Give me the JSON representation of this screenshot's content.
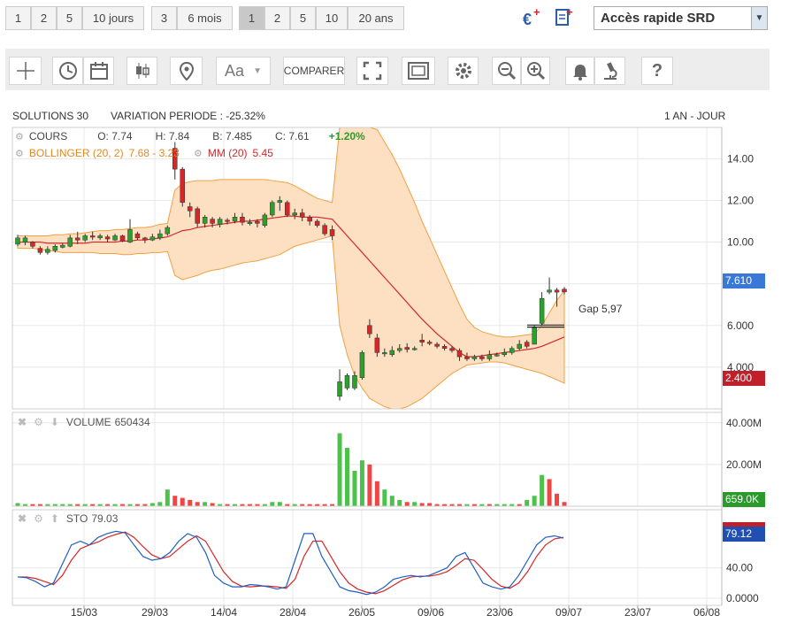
{
  "ranges_days": [
    "1",
    "2",
    "5",
    "10 jours"
  ],
  "ranges_months": [
    "3",
    "6 mois"
  ],
  "ranges_years": [
    "1",
    "2",
    "5",
    "10",
    "20 ans"
  ],
  "quick_access": "Accès rapide SRD",
  "compare_label": "COMPARER",
  "font_label": "Aa",
  "header": {
    "name": "SOLUTIONS 30",
    "variation": "VARIATION PERIODE : -25.32%",
    "period": "1 AN - JOUR"
  },
  "cours": {
    "label": "COURS",
    "o": "O: 7.74",
    "h": "H: 7.84",
    "b": "B: 7.485",
    "c": "C: 7.61",
    "change": "+1.20%"
  },
  "bollinger": {
    "label": "BOLLINGER (20, 2)",
    "values": "7.68 - 3.23"
  },
  "mm": {
    "label": "MM (20)",
    "value": "5.45"
  },
  "volume": {
    "label": "VOLUME",
    "value": "650434"
  },
  "sto": {
    "label": "STO",
    "value": "79.03"
  },
  "gap_label": "Gap 5,97",
  "badges": {
    "last_price": "7.610",
    "low_price": "2.400",
    "volume": "659.0K",
    "sto": "79.12"
  },
  "colors": {
    "up": "#2ca02c",
    "down": "#d62728",
    "band_fill": "#fde0c2",
    "band_line": "#f0a040",
    "mm": "#d62728",
    "sto_k": "#1f5fbf",
    "sto_d": "#d62728",
    "price_badge": "#3a78d8",
    "low_badge": "#c0202a",
    "vol_badge": "#2a9a2a"
  },
  "chart_data": {
    "type": "candlestick",
    "x_ticks": [
      "15/03",
      "29/03",
      "14/04",
      "28/04",
      "26/05",
      "09/06",
      "23/06",
      "09/07",
      "23/07",
      "06/08"
    ],
    "price_axis": {
      "ticks": [
        "14.00",
        "12.00",
        "10.00",
        "8.000",
        "6.000",
        "4.000"
      ],
      "ylim": [
        2.0,
        15.5
      ]
    },
    "volume_axis": {
      "ticks": [
        "40.00M",
        "20.00M"
      ]
    },
    "sto_axis": {
      "ticks": [
        "40.00",
        "0.0000"
      ]
    },
    "candles": [
      {
        "o": 9.9,
        "c": 10.2,
        "h": 10.35,
        "l": 9.8
      },
      {
        "o": 10.0,
        "c": 10.2,
        "h": 10.3,
        "l": 9.85
      },
      {
        "o": 10.0,
        "c": 9.8,
        "h": 10.05,
        "l": 9.7
      },
      {
        "o": 9.7,
        "c": 9.5,
        "h": 9.8,
        "l": 9.4
      },
      {
        "o": 9.5,
        "c": 9.65,
        "h": 9.8,
        "l": 9.4
      },
      {
        "o": 9.6,
        "c": 9.8,
        "h": 9.9,
        "l": 9.5
      },
      {
        "o": 9.75,
        "c": 9.85,
        "h": 9.95,
        "l": 9.7
      },
      {
        "o": 9.8,
        "c": 10.2,
        "h": 10.35,
        "l": 9.75
      },
      {
        "o": 10.2,
        "c": 10.1,
        "h": 10.5,
        "l": 9.9
      },
      {
        "o": 10.1,
        "c": 10.3,
        "h": 10.4,
        "l": 10.0
      },
      {
        "o": 10.3,
        "c": 10.25,
        "h": 10.5,
        "l": 10.1
      },
      {
        "o": 10.2,
        "c": 10.3,
        "h": 10.4,
        "l": 10.1
      },
      {
        "o": 10.25,
        "c": 10.15,
        "h": 10.35,
        "l": 10.0
      },
      {
        "o": 10.1,
        "c": 10.3,
        "h": 10.4,
        "l": 10.05
      },
      {
        "o": 10.3,
        "c": 10.05,
        "h": 10.35,
        "l": 10.0
      },
      {
        "o": 10.0,
        "c": 10.6,
        "h": 11.1,
        "l": 9.95
      },
      {
        "o": 10.4,
        "c": 10.2,
        "h": 10.5,
        "l": 10.1
      },
      {
        "o": 10.2,
        "c": 10.1,
        "h": 10.25,
        "l": 9.95
      },
      {
        "o": 10.1,
        "c": 10.25,
        "h": 10.4,
        "l": 10.05
      },
      {
        "o": 10.2,
        "c": 10.4,
        "h": 10.6,
        "l": 10.1
      },
      {
        "o": 10.4,
        "c": 10.7,
        "h": 10.8,
        "l": 10.3
      },
      {
        "o": 14.5,
        "c": 13.5,
        "h": 14.8,
        "l": 13.0
      },
      {
        "o": 13.5,
        "c": 11.9,
        "h": 13.6,
        "l": 11.7
      },
      {
        "o": 11.7,
        "c": 11.5,
        "h": 11.9,
        "l": 11.2
      },
      {
        "o": 11.6,
        "c": 10.9,
        "h": 11.7,
        "l": 10.7
      },
      {
        "o": 10.9,
        "c": 11.2,
        "h": 11.3,
        "l": 10.7
      },
      {
        "o": 11.1,
        "c": 10.9,
        "h": 11.2,
        "l": 10.7
      },
      {
        "o": 10.85,
        "c": 11.1,
        "h": 11.2,
        "l": 10.7
      },
      {
        "o": 11.05,
        "c": 11.0,
        "h": 11.15,
        "l": 10.85
      },
      {
        "o": 11.0,
        "c": 11.2,
        "h": 11.4,
        "l": 10.9
      },
      {
        "o": 11.2,
        "c": 10.95,
        "h": 11.4,
        "l": 10.8
      },
      {
        "o": 10.9,
        "c": 10.95,
        "h": 11.1,
        "l": 10.8
      },
      {
        "o": 11.0,
        "c": 10.9,
        "h": 11.1,
        "l": 10.7
      },
      {
        "o": 10.8,
        "c": 11.3,
        "h": 11.4,
        "l": 10.7
      },
      {
        "o": 11.3,
        "c": 11.9,
        "h": 12.0,
        "l": 11.2
      },
      {
        "o": 11.9,
        "c": 12.0,
        "h": 12.2,
        "l": 11.5
      },
      {
        "o": 11.9,
        "c": 11.3,
        "h": 12.0,
        "l": 11.2
      },
      {
        "o": 11.3,
        "c": 11.4,
        "h": 11.6,
        "l": 11.1
      },
      {
        "o": 11.4,
        "c": 11.2,
        "h": 11.6,
        "l": 11.0
      },
      {
        "o": 11.2,
        "c": 11.0,
        "h": 11.3,
        "l": 10.8
      },
      {
        "o": 11.0,
        "c": 10.8,
        "h": 11.1,
        "l": 10.7
      },
      {
        "o": 10.8,
        "c": 10.4,
        "h": 10.9,
        "l": 10.3
      },
      {
        "o": 10.6,
        "c": 10.3,
        "h": 10.8,
        "l": 10.1
      },
      {
        "o": 2.6,
        "c": 3.3,
        "h": 3.9,
        "l": 2.4
      },
      {
        "o": 3.0,
        "c": 3.6,
        "h": 3.7,
        "l": 2.9
      },
      {
        "o": 3.0,
        "c": 3.6,
        "h": 3.8,
        "l": 2.9
      },
      {
        "o": 3.5,
        "c": 4.7,
        "h": 4.8,
        "l": 3.4
      },
      {
        "o": 6.0,
        "c": 5.6,
        "h": 6.3,
        "l": 5.4
      },
      {
        "o": 5.4,
        "c": 4.7,
        "h": 5.6,
        "l": 4.5
      },
      {
        "o": 4.7,
        "c": 4.7,
        "h": 4.9,
        "l": 4.5
      },
      {
        "o": 4.6,
        "c": 4.8,
        "h": 5.0,
        "l": 4.5
      },
      {
        "o": 4.8,
        "c": 4.9,
        "h": 5.1,
        "l": 4.7
      },
      {
        "o": 4.95,
        "c": 4.85,
        "h": 5.15,
        "l": 4.7
      },
      {
        "o": 4.9,
        "c": 4.9,
        "h": 5.0,
        "l": 4.8
      },
      {
        "o": 5.3,
        "c": 5.2,
        "h": 5.6,
        "l": 5.0
      },
      {
        "o": 5.2,
        "c": 5.15,
        "h": 5.3,
        "l": 5.05
      },
      {
        "o": 5.1,
        "c": 5.0,
        "h": 5.2,
        "l": 4.9
      },
      {
        "o": 5.0,
        "c": 4.9,
        "h": 5.1,
        "l": 4.8
      },
      {
        "o": 4.9,
        "c": 4.8,
        "h": 5.0,
        "l": 4.7
      },
      {
        "o": 4.8,
        "c": 4.5,
        "h": 4.9,
        "l": 4.3
      },
      {
        "o": 4.5,
        "c": 4.4,
        "h": 4.7,
        "l": 4.3
      },
      {
        "o": 4.4,
        "c": 4.5,
        "h": 4.6,
        "l": 4.3
      },
      {
        "o": 4.5,
        "c": 4.4,
        "h": 4.6,
        "l": 4.3
      },
      {
        "o": 4.4,
        "c": 4.6,
        "h": 4.8,
        "l": 4.3
      },
      {
        "o": 4.6,
        "c": 4.6,
        "h": 4.7,
        "l": 4.5
      },
      {
        "o": 4.6,
        "c": 4.7,
        "h": 4.9,
        "l": 4.5
      },
      {
        "o": 4.7,
        "c": 4.9,
        "h": 5.0,
        "l": 4.6
      },
      {
        "o": 4.9,
        "c": 5.1,
        "h": 5.3,
        "l": 4.8
      },
      {
        "o": 5.2,
        "c": 5.0,
        "h": 5.3,
        "l": 4.9
      },
      {
        "o": 5.1,
        "c": 5.9,
        "h": 6.0,
        "l": 5.1
      },
      {
        "o": 6.1,
        "c": 7.3,
        "h": 7.6,
        "l": 6.0
      },
      {
        "o": 7.6,
        "c": 7.7,
        "h": 8.3,
        "l": 7.5
      },
      {
        "o": 7.7,
        "c": 7.6,
        "h": 7.8,
        "l": 6.9
      },
      {
        "o": 7.74,
        "c": 7.61,
        "h": 7.84,
        "l": 7.485
      }
    ],
    "mm20": [
      10.0,
      10.0,
      10.0,
      10.0,
      9.95,
      9.95,
      9.95,
      9.95,
      9.95,
      9.95,
      10.0,
      10.0,
      10.0,
      10.0,
      10.05,
      10.05,
      10.1,
      10.1,
      10.15,
      10.2,
      10.25,
      10.4,
      10.55,
      10.6,
      10.7,
      10.75,
      10.8,
      10.85,
      10.9,
      10.95,
      11.0,
      11.0,
      11.05,
      11.1,
      11.15,
      11.2,
      11.25,
      11.25,
      11.2,
      11.2,
      11.2,
      11.15,
      11.1,
      10.7,
      10.3,
      9.9,
      9.5,
      9.1,
      8.7,
      8.3,
      7.9,
      7.5,
      7.1,
      6.7,
      6.3,
      5.95,
      5.6,
      5.3,
      5.0,
      4.7,
      4.5,
      4.5,
      4.55,
      4.6,
      4.65,
      4.7,
      4.75,
      4.8,
      4.85,
      4.9,
      5.0,
      5.15,
      5.3,
      5.45
    ],
    "boll_upper": [
      10.3,
      10.3,
      10.3,
      10.3,
      10.3,
      10.35,
      10.35,
      10.4,
      10.4,
      10.45,
      10.5,
      10.55,
      10.55,
      10.6,
      10.6,
      10.65,
      10.7,
      10.7,
      10.75,
      10.85,
      10.9,
      12.5,
      12.8,
      12.9,
      12.95,
      12.95,
      12.95,
      13.0,
      13.0,
      13.0,
      13.0,
      13.0,
      13.0,
      13.0,
      12.95,
      12.9,
      12.85,
      12.7,
      12.5,
      12.3,
      12.1,
      12.0,
      11.9,
      15.5,
      16.0,
      16.2,
      16.0,
      15.8,
      15.4,
      14.8,
      14.2,
      13.5,
      12.7,
      11.9,
      11.0,
      10.2,
      9.4,
      8.6,
      7.8,
      7.0,
      6.3,
      5.9,
      5.7,
      5.6,
      5.5,
      5.45,
      5.45,
      5.5,
      5.55,
      5.6,
      6.0,
      6.6,
      7.2,
      7.68
    ],
    "boll_lower": [
      9.7,
      9.7,
      9.7,
      9.65,
      9.6,
      9.55,
      9.5,
      9.5,
      9.5,
      9.5,
      9.5,
      9.45,
      9.45,
      9.45,
      9.4,
      9.4,
      9.45,
      9.45,
      9.5,
      9.5,
      9.55,
      8.4,
      8.2,
      8.3,
      8.4,
      8.55,
      8.65,
      8.7,
      8.8,
      8.9,
      9.0,
      9.05,
      9.1,
      9.2,
      9.3,
      9.4,
      9.6,
      9.8,
      9.9,
      10.0,
      10.1,
      10.2,
      10.3,
      6.0,
      4.6,
      3.6,
      3.0,
      2.5,
      2.3,
      2.1,
      2.0,
      2.0,
      2.1,
      2.3,
      2.5,
      2.8,
      3.1,
      3.4,
      3.7,
      3.9,
      4.1,
      4.15,
      4.2,
      4.25,
      4.25,
      4.2,
      4.1,
      4.0,
      3.9,
      3.8,
      3.7,
      3.55,
      3.4,
      3.23
    ],
    "volume_millions": [
      1.5,
      1,
      1,
      1,
      1,
      1,
      1,
      1,
      1,
      1,
      1,
      1,
      1,
      1,
      1,
      1,
      1,
      1,
      1.5,
      2,
      8,
      5,
      4,
      3,
      2,
      2,
      1.5,
      1,
      1,
      1,
      1,
      1,
      1,
      1,
      2,
      2,
      1,
      1,
      1,
      1,
      1,
      1,
      1,
      35,
      28,
      17,
      22,
      20,
      12,
      8,
      5,
      3,
      2,
      2,
      1.5,
      1.5,
      1,
      1,
      1,
      1,
      1,
      1,
      1,
      1,
      1,
      1,
      1,
      1,
      3,
      5,
      15,
      13,
      6,
      2
    ],
    "volume_up": [
      true,
      true,
      false,
      false,
      true,
      true,
      true,
      true,
      false,
      true,
      false,
      true,
      false,
      true,
      false,
      true,
      false,
      false,
      true,
      true,
      true,
      false,
      false,
      false,
      false,
      true,
      false,
      true,
      false,
      true,
      false,
      false,
      false,
      true,
      true,
      true,
      false,
      true,
      false,
      false,
      false,
      false,
      false,
      true,
      true,
      true,
      true,
      false,
      false,
      true,
      true,
      true,
      false,
      true,
      false,
      false,
      false,
      false,
      false,
      false,
      true,
      false,
      true,
      false,
      true,
      true,
      true,
      false,
      true,
      true,
      true,
      false,
      false,
      false
    ],
    "sto_k": [
      28,
      27,
      22,
      15,
      20,
      45,
      70,
      75,
      70,
      80,
      85,
      88,
      86,
      70,
      55,
      50,
      52,
      60,
      75,
      85,
      80,
      60,
      30,
      20,
      15,
      15,
      18,
      17,
      15,
      12,
      15,
      50,
      85,
      85,
      55,
      35,
      15,
      10,
      8,
      5,
      8,
      15,
      25,
      28,
      30,
      28,
      30,
      35,
      40,
      55,
      60,
      40,
      20,
      15,
      12,
      15,
      30,
      50,
      70,
      80,
      82,
      79
    ],
    "sto_d": [
      28,
      28,
      26,
      22,
      18,
      30,
      50,
      65,
      70,
      74,
      80,
      84,
      87,
      80,
      68,
      57,
      52,
      55,
      65,
      75,
      82,
      75,
      55,
      35,
      22,
      16,
      15,
      16,
      16,
      15,
      13,
      25,
      55,
      75,
      75,
      55,
      35,
      20,
      12,
      8,
      6,
      10,
      17,
      24,
      28,
      29,
      29,
      31,
      35,
      43,
      52,
      50,
      38,
      25,
      16,
      13,
      20,
      35,
      55,
      70,
      78,
      80
    ]
  }
}
